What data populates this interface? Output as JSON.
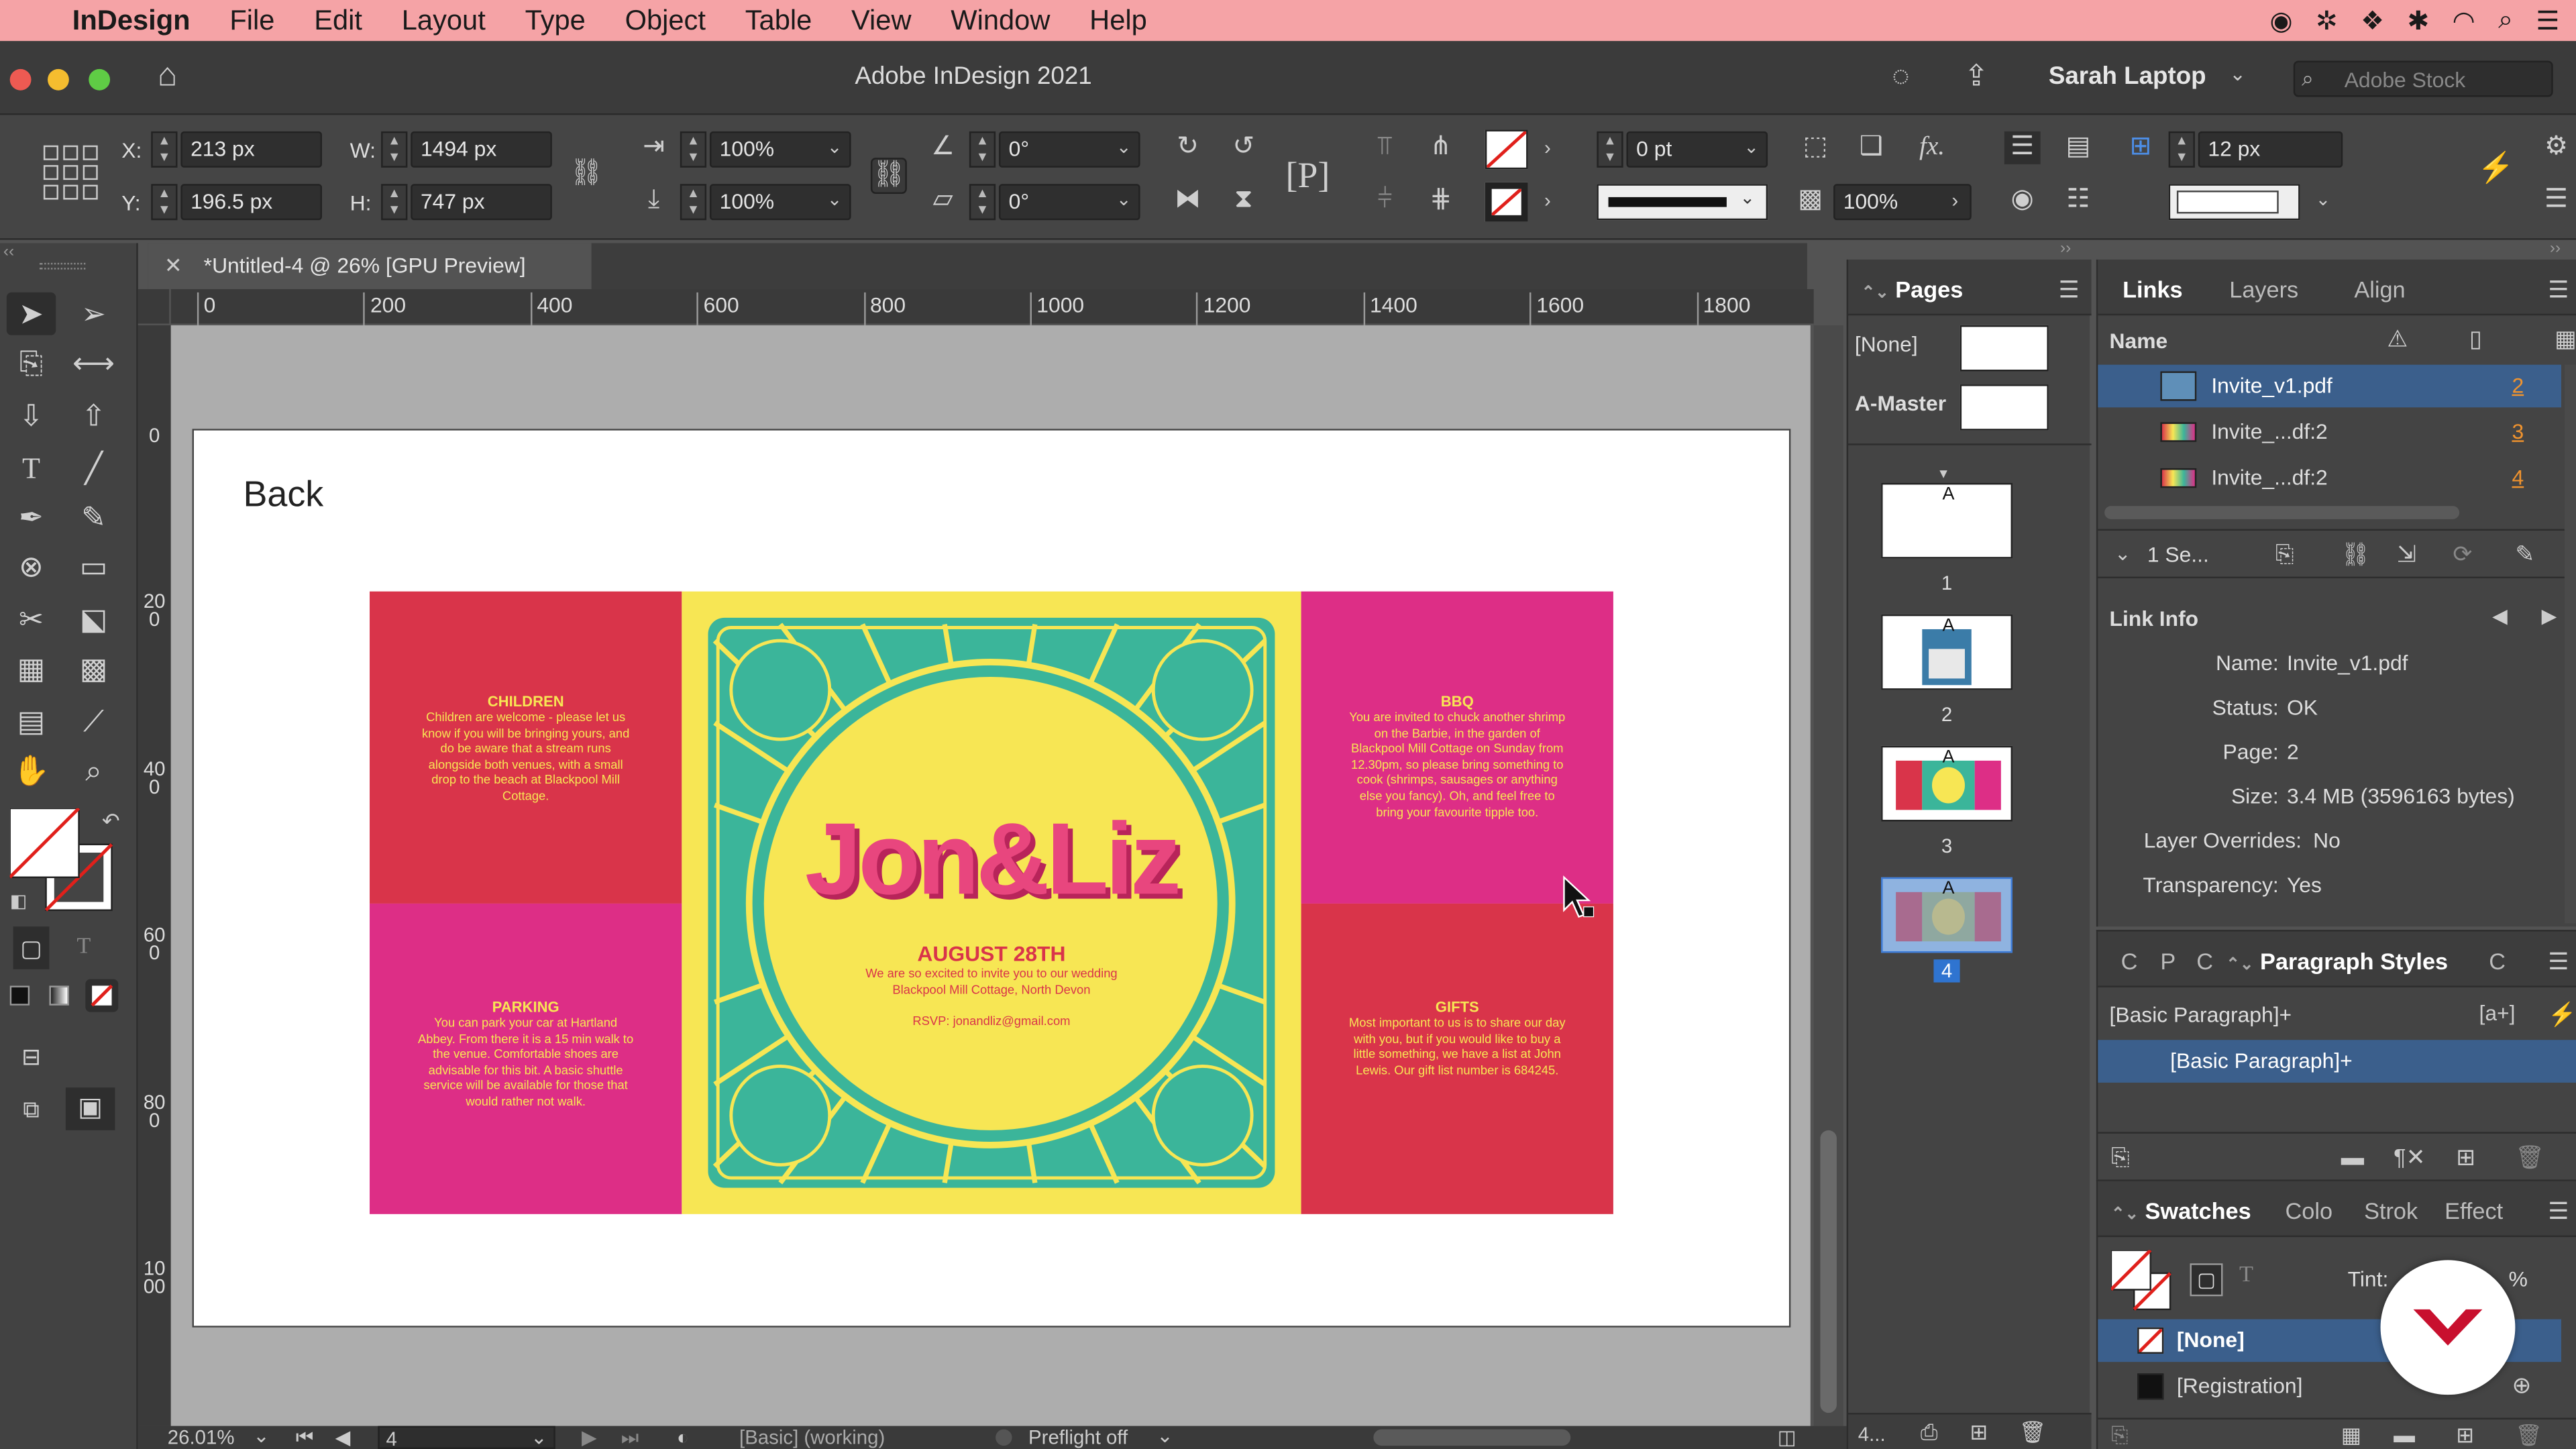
{
  "menubar": {
    "apple": "",
    "app": "InDesign",
    "items": [
      "File",
      "Edit",
      "Layout",
      "Type",
      "Object",
      "Table",
      "View",
      "Window",
      "Help"
    ]
  },
  "titlebar": {
    "title": "Adobe InDesign 2021",
    "workspace": "Sarah Laptop",
    "stock_placeholder": "Adobe Stock"
  },
  "control": {
    "x_label": "X:",
    "x": "213 px",
    "y_label": "Y:",
    "y": "196.5 px",
    "w_label": "W:",
    "w": "1494 px",
    "h_label": "H:",
    "h": "747 px",
    "scale_x": "100%",
    "scale_y": "100%",
    "angle1": "0°",
    "angle2": "0°",
    "stroke_weight": "0 pt",
    "opacity": "100%",
    "gutter": "12 px"
  },
  "tab": {
    "title": "*Untitled-4 @ 26% [GPU Preview]"
  },
  "ruler": {
    "h_ticks": [
      "0",
      "200",
      "400",
      "600",
      "800",
      "1000",
      "1200",
      "1400",
      "1600",
      "1800"
    ],
    "v_ticks": [
      "0",
      "200",
      "400",
      "600",
      "800",
      "1000"
    ]
  },
  "page": {
    "label": "Back"
  },
  "invite": {
    "children_title": "CHILDREN",
    "children_text": "Children are welcome - please let us know if you will be bringing yours, and do be aware that a stream runs alongside both venues, with a small drop to the beach at Blackpool Mill Cottage.",
    "bbq_title": "BBQ",
    "bbq_text": "You are invited to chuck another shrimp on the Barbie, in the garden of Blackpool Mill Cottage on Sunday from 12.30pm, so please bring something to cook (shrimps, sausages or anything else you fancy). Oh, and feel free to bring your favourite tipple too.",
    "parking_title": "PARKING",
    "parking_text": "You can park your car at Hartland Abbey. From there it is a 15 min walk to the venue. Comfortable shoes are advisable for this bit. A basic shuttle service will be available for those that would rather not walk.",
    "gifts_title": "GIFTS",
    "gifts_text": "Most important to us is to share our day with you, but if you would like to buy a little something, we have a list at John Lewis. Our gift list number is 684245.",
    "names": "Jon&Liz",
    "date": "AUGUST 28TH",
    "invite_text": "We are so excited to invite you to our wedding Blackpool Mill Cottage, North Devon",
    "rsvp": "RSVP: jonandliz@gmail.com"
  },
  "status": {
    "zoom": "26.01%",
    "page": "4",
    "style": "[Basic] (working)",
    "preflight": "Preflight off"
  },
  "pages_panel": {
    "title": "Pages",
    "none": "[None]",
    "master": "A-Master",
    "pages": [
      "1",
      "2",
      "3",
      "4"
    ],
    "master_letter": "A",
    "footer": "4..."
  },
  "links_panel": {
    "tabs": [
      "Links",
      "Layers",
      "Align"
    ],
    "col_name": "Name",
    "links": [
      {
        "name": "Invite_v1.pdf",
        "page": "2"
      },
      {
        "name": "Invite_...df:2",
        "page": "3"
      },
      {
        "name": "Invite_...df:2",
        "page": "4"
      }
    ],
    "selected": "1 Se...",
    "link_info_title": "Link Info",
    "info": [
      {
        "k": "Name:",
        "v": "Invite_v1.pdf"
      },
      {
        "k": "Status:",
        "v": "OK"
      },
      {
        "k": "Page:",
        "v": "2"
      },
      {
        "k": "Size:",
        "v": "3.4 MB (3596163 bytes)"
      },
      {
        "k": "Layer Overrides:",
        "v": "No"
      },
      {
        "k": "Transparency:",
        "v": "Yes"
      }
    ]
  },
  "para_panel": {
    "tabs": [
      "C",
      "P",
      "C",
      "Paragraph Styles",
      "C"
    ],
    "current": "[Basic Paragraph]+",
    "item": "[Basic Paragraph]+"
  },
  "swatches_panel": {
    "tabs": [
      "Swatches",
      "Colo",
      "Strok",
      "Effect"
    ],
    "tint_label": "Tint:",
    "tint_unit": "%",
    "items": [
      "[None]",
      "[Registration]"
    ]
  },
  "colors": {
    "accent": "#f5a3a6",
    "invite_red": "#d9344a",
    "invite_pink": "#dd2e86",
    "invite_yellow": "#f7e654",
    "invite_teal": "#3bb59a"
  }
}
